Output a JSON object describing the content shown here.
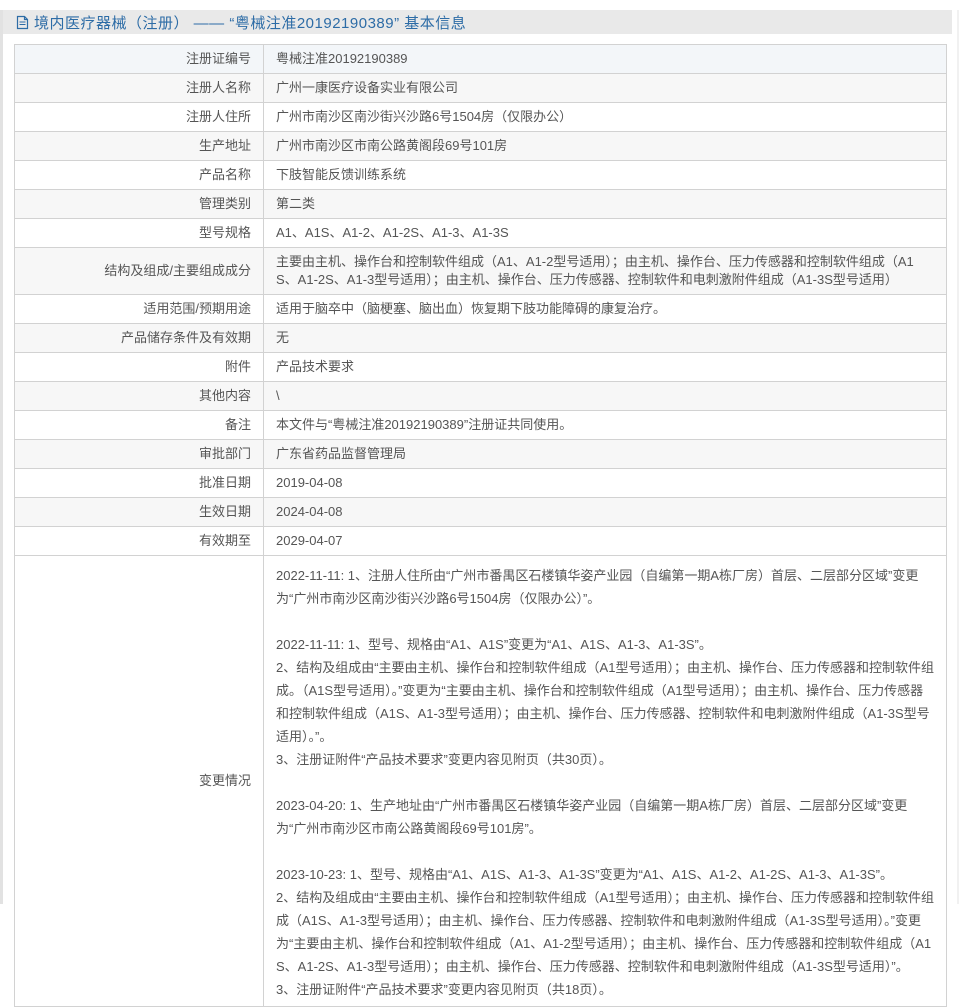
{
  "colors": {
    "accent_blue": "#2d6ca6",
    "header_bar_bg": "#e9e9e9",
    "shaded_row_bg": "#f7f7f7",
    "first_row_bg": "#f3f6f9",
    "table_border": "#d2d2d2",
    "body_text": "#555555"
  },
  "header": {
    "icon": "document-icon",
    "title": "境内医疗器械（注册） —— “粤械注准20192190389” 基本信息"
  },
  "table": {
    "rows": [
      {
        "label": "注册证编号",
        "value": "粤械注准20192190389",
        "shaded": true,
        "first": true
      },
      {
        "label": "注册人名称",
        "value": "广州一康医疗设备实业有限公司",
        "shaded": true
      },
      {
        "label": "注册人住所",
        "value": "广州市南沙区南沙街兴沙路6号1504房（仅限办公）",
        "shaded": false
      },
      {
        "label": "生产地址",
        "value": "广州市南沙区市南公路黄阁段69号101房",
        "shaded": true
      },
      {
        "label": "产品名称",
        "value": "下肢智能反馈训练系统",
        "shaded": false
      },
      {
        "label": "管理类别",
        "value": "第二类",
        "shaded": true
      },
      {
        "label": "型号规格",
        "value": "A1、A1S、A1-2、A1-2S、A1-3、A1-3S",
        "shaded": false
      },
      {
        "label": "结构及组成/主要组成成分",
        "value": "主要由主机、操作台和控制软件组成（A1、A1-2型号适用）；由主机、操作台、压力传感器和控制软件组成（A1S、A1-2S、A1-3型号适用）；由主机、操作台、压力传感器、控制软件和电刺激附件组成（A1-3S型号适用）",
        "shaded": true,
        "multiline": true
      },
      {
        "label": "适用范围/预期用途",
        "value": "适用于脑卒中（脑梗塞、脑出血）恢复期下肢功能障碍的康复治疗。",
        "shaded": false
      },
      {
        "label": "产品储存条件及有效期",
        "value": "无",
        "shaded": true
      },
      {
        "label": "附件",
        "value": "产品技术要求",
        "shaded": false
      },
      {
        "label": "其他内容",
        "value": "\\",
        "shaded": true
      },
      {
        "label": "备注",
        "value": "本文件与“粤械注准20192190389”注册证共同使用。",
        "shaded": false
      },
      {
        "label": "审批部门",
        "value": "广东省药品监督管理局",
        "shaded": true
      },
      {
        "label": "批准日期",
        "value": "2019-04-08",
        "shaded": false
      },
      {
        "label": "生效日期",
        "value": "2024-04-08",
        "shaded": true
      },
      {
        "label": "有效期至",
        "value": "2029-04-07",
        "shaded": false
      }
    ],
    "change_row": {
      "label": "变更情况",
      "paragraphs": [
        {
          "lines": [
            "2022-11-11: 1、注册人住所由“广州市番禺区石楼镇华姿产业园（自编第一期A栋厂房）首层、二层部分区域”变更为“广州市南沙区南沙街兴沙路6号1504房（仅限办公）”。"
          ]
        },
        {
          "lines": [
            "2022-11-11: 1、型号、规格由“A1、A1S”变更为“A1、A1S、A1-3、A1-3S”。",
            "2、结构及组成由“主要由主机、操作台和控制软件组成（A1型号适用）；由主机、操作台、压力传感器和控制软件组成。（A1S型号适用）。”变更为“主要由主机、操作台和控制软件组成（A1型号适用）；由主机、操作台、压力传感器和控制软件组成（A1S、A1-3型号适用）；由主机、操作台、压力传感器、控制软件和电刺激附件组成（A1-3S型号适用）。”。",
            "3、注册证附件“产品技术要求”变更内容见附页（共30页）。"
          ]
        },
        {
          "lines": [
            "2023-04-20: 1、生产地址由“广州市番禺区石楼镇华姿产业园（自编第一期A栋厂房）首层、二层部分区域”变更为“广州市南沙区市南公路黄阁段69号101房”。"
          ]
        },
        {
          "lines": [
            "2023-10-23: 1、型号、规格由“A1、A1S、A1-3、A1-3S”变更为“A1、A1S、A1-2、A1-2S、A1-3、A1-3S”。",
            "2、结构及组成由“主要由主机、操作台和控制软件组成（A1型号适用）；由主机、操作台、压力传感器和控制软件组成（A1S、A1-3型号适用）；由主机、操作台、压力传感器、控制软件和电刺激附件组成（A1-3S型号适用）。”变更为“主要由主机、操作台和控制软件组成（A1、A1-2型号适用）；由主机、操作台、压力传感器和控制软件组成（A1S、A1-2S、A1-3型号适用）；由主机、操作台、压力传感器、控制软件和电刺激附件组成（A1-3S型号适用）”。",
            "3、注册证附件“产品技术要求”变更内容见附页（共18页）。"
          ]
        }
      ]
    }
  }
}
